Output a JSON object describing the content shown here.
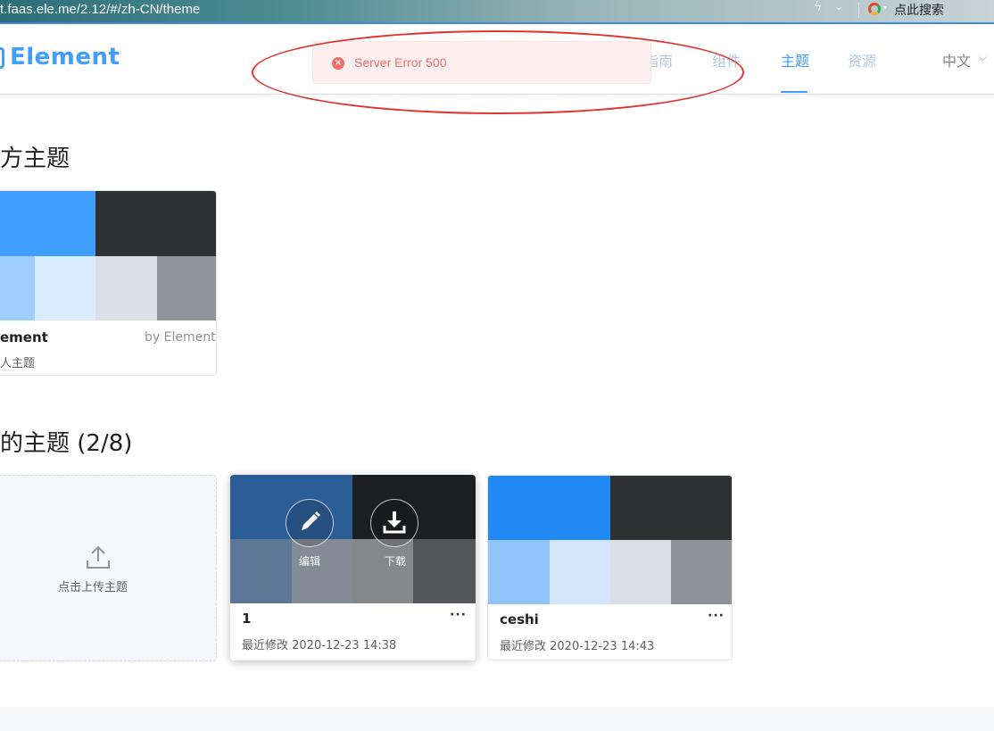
{
  "browser": {
    "url": "t.faas.ele.me/2.12/#/zh-CN/theme",
    "search_label": "点此搜索"
  },
  "header": {
    "logo_text": "Element",
    "nav": [
      {
        "label": "指南"
      },
      {
        "label": "组件"
      },
      {
        "label": "主题"
      },
      {
        "label": "资源"
      }
    ],
    "language": "中文"
  },
  "message": {
    "text": "Server Error 500",
    "type": "error"
  },
  "official": {
    "title": "方主题",
    "card": {
      "name": "ement",
      "author": "by Element",
      "desc": "人主题",
      "colors": {
        "primary": "#409eff",
        "dark": "#303133",
        "light1": "#a0cfff",
        "light2": "#d9ecff",
        "gray1": "#dcdfe6",
        "gray2": "#909399"
      }
    }
  },
  "mine": {
    "title": "的主题 (2/8)",
    "upload_label": "点击上传主题",
    "cards": [
      {
        "name": "1",
        "more": "···",
        "modified": "最近修改 2020-12-23 14:38",
        "edit_label": "编辑",
        "download_label": "下载"
      },
      {
        "name": "ceshi",
        "more": "···",
        "modified": "最近修改 2020-12-23 14:43"
      }
    ]
  }
}
